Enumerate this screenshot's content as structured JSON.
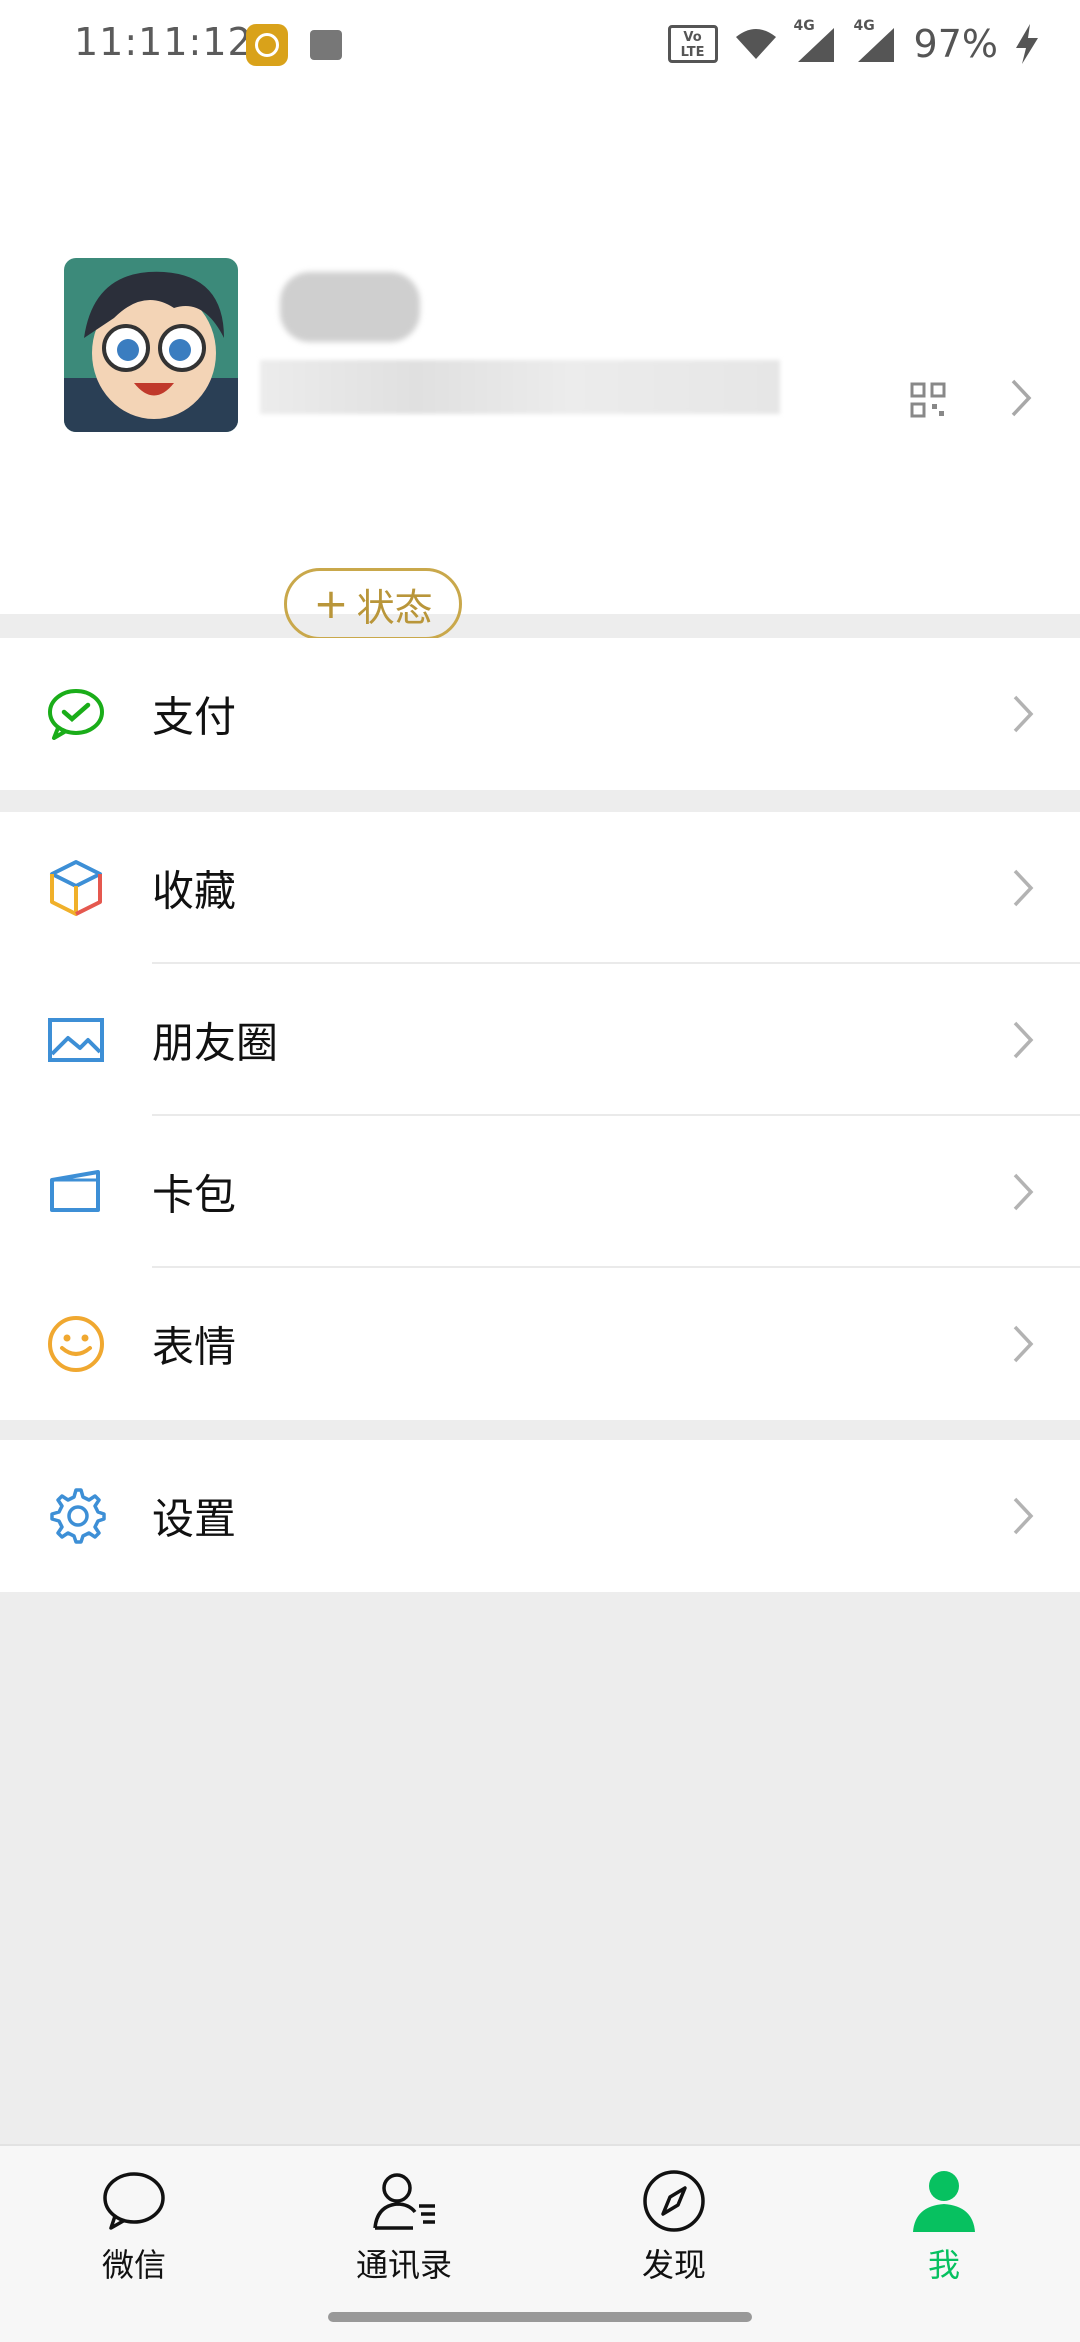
{
  "status_bar": {
    "time": "11:11:12",
    "battery": "97%",
    "volte_label": "Vo LTE",
    "signal_tags": [
      "4G",
      "4G"
    ]
  },
  "profile": {
    "status_button_plus": "+",
    "status_button_label": "状态"
  },
  "menu": {
    "pay": {
      "label": "支付",
      "icon": "wechat-pay-icon"
    },
    "favorites": {
      "label": "收藏",
      "icon": "cube-icon"
    },
    "moments": {
      "label": "朋友圈",
      "icon": "image-icon"
    },
    "cards": {
      "label": "卡包",
      "icon": "card-icon"
    },
    "stickers": {
      "label": "表情",
      "icon": "smiley-icon"
    },
    "settings": {
      "label": "设置",
      "icon": "gear-icon"
    }
  },
  "tabbar": {
    "tabs": [
      {
        "label": "微信",
        "icon": "chat-bubble-icon"
      },
      {
        "label": "通讯录",
        "icon": "contacts-icon"
      },
      {
        "label": "发现",
        "icon": "compass-icon"
      },
      {
        "label": "我",
        "icon": "person-icon"
      }
    ],
    "active_index": 3
  },
  "colors": {
    "accent_green": "#07c160",
    "status_gold": "#c9a84b",
    "background": "#ededed"
  }
}
